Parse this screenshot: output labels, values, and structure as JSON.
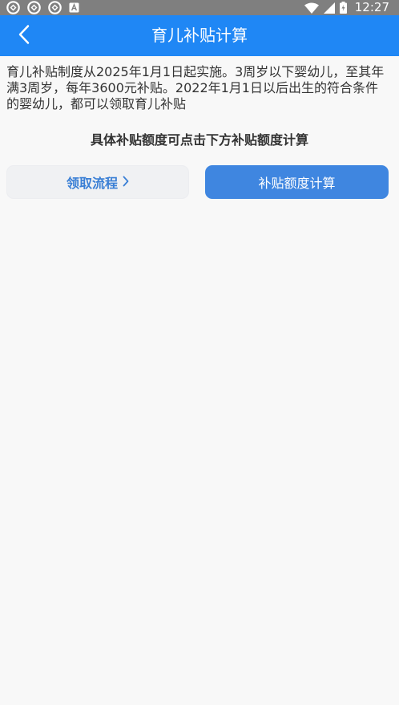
{
  "status_bar": {
    "time": "12:27",
    "left_icons": [
      "sync-icon",
      "sync-icon",
      "sync-icon",
      "keyboard-a-icon"
    ],
    "right_icons": [
      "wifi-icon",
      "signal-icon",
      "battery-icon"
    ]
  },
  "header": {
    "title": "育儿补贴计算",
    "back_icon": "back-arrow-icon",
    "background_color": "#1f87f5"
  },
  "content": {
    "intro": "育儿补贴制度从2025年1月1日起实施。3周岁以下婴幼儿，至其年满3周岁，每年3600元补贴。2022年1月1日以后出生的符合条件的婴幼儿，都可以领取育儿补贴",
    "hint": "具体补贴额度可点击下方补贴额度计算"
  },
  "buttons": {
    "process_label": "领取流程",
    "calc_label": "补贴额度计算",
    "calc_color": "#3f86e0"
  }
}
